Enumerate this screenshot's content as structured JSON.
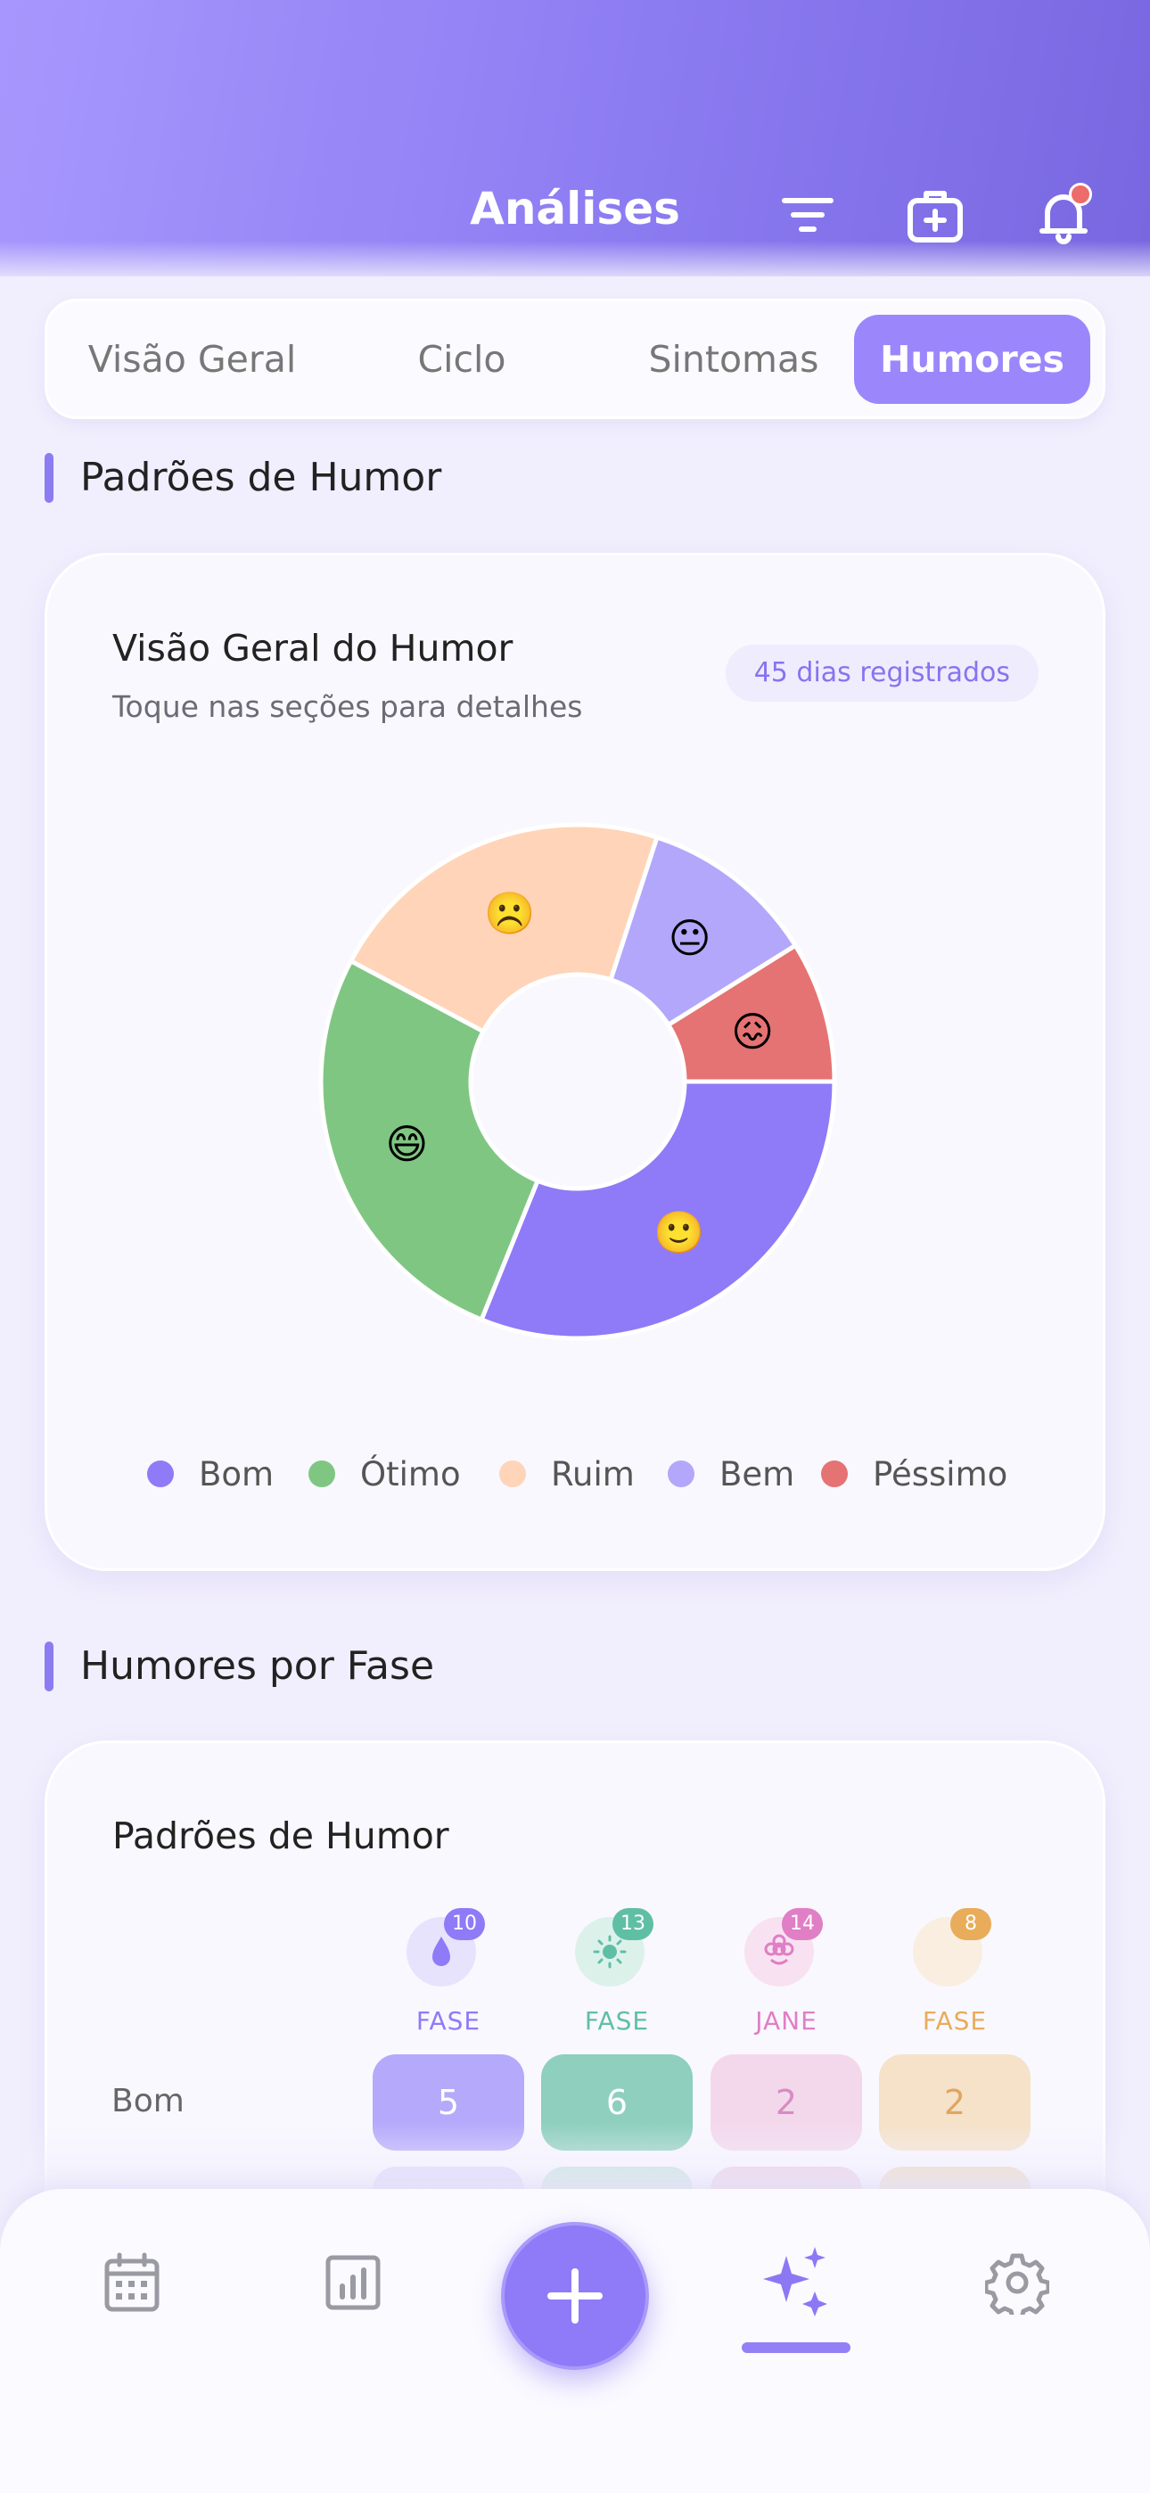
{
  "header": {
    "title": "Análises"
  },
  "tabs": [
    {
      "label": "Visão Geral",
      "active": false
    },
    {
      "label": "Ciclo",
      "active": false
    },
    {
      "label": "Sintomas",
      "active": false
    },
    {
      "label": "Humores",
      "active": true
    }
  ],
  "sections": {
    "mood_patterns": "Padrões de Humor",
    "moods_by_phase": "Humores por Fase"
  },
  "mood_card": {
    "title": "Visão Geral do Humor",
    "subtitle": "Toque nas seções para detalhes",
    "days_badge": "45 dias registrados"
  },
  "chart_data": {
    "type": "pie",
    "donut": true,
    "slices": [
      {
        "label": "Bom",
        "value": 14,
        "color": "#8f7af8",
        "emoji": "🙂"
      },
      {
        "label": "Ótimo",
        "value": 12,
        "color": "#80c683",
        "emoji": "😄"
      },
      {
        "label": "Ruim",
        "value": 10,
        "color": "#ffd4b8",
        "emoji": "☹️"
      },
      {
        "label": "Bem",
        "value": 5,
        "color": "#b3a7fb",
        "emoji": "😐"
      },
      {
        "label": "Péssimo",
        "value": 4,
        "color": "#e57373",
        "emoji": "😖"
      }
    ],
    "legend": [
      "Bom",
      "Ótimo",
      "Ruim",
      "Bem",
      "Péssimo"
    ],
    "legend_placement": "bottom"
  },
  "phase_card": {
    "title": "Padrões de Humor",
    "phases": [
      {
        "label": "FASE",
        "count": "10",
        "icon": "drop-icon",
        "color": "#8f7af8"
      },
      {
        "label": "FASE",
        "count": "13",
        "icon": "sun-icon",
        "color": "#5fbfa5"
      },
      {
        "label": "JANE",
        "count": "14",
        "icon": "flower-icon",
        "color": "#e07ec6"
      },
      {
        "label": "FASE",
        "count": "8",
        "icon": "moon-icon",
        "color": "#e8ac5a"
      }
    ],
    "rows": [
      {
        "label": "Bom",
        "values": [
          "5",
          "6",
          "2",
          "2"
        ]
      }
    ]
  },
  "bottom_nav": {
    "items": [
      {
        "icon": "calendar-icon"
      },
      {
        "icon": "chart-icon"
      },
      {
        "icon": "plus-icon"
      },
      {
        "icon": "sparkles-icon",
        "active": true
      },
      {
        "icon": "gear-icon"
      }
    ]
  }
}
